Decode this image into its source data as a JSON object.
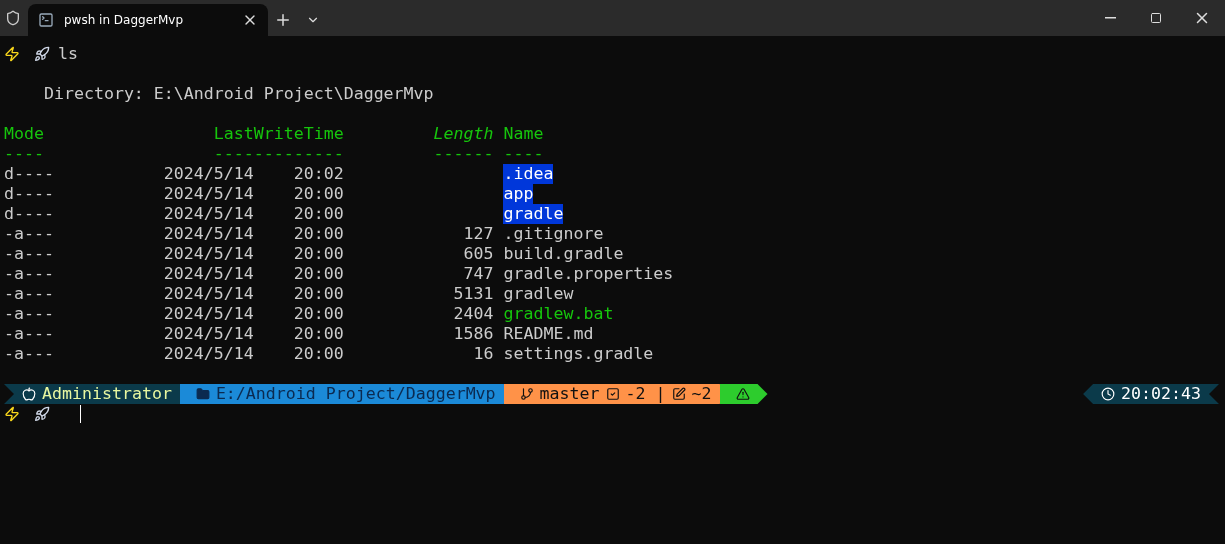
{
  "window": {
    "tabs": [
      {
        "title": "pwsh in DaggerMvp",
        "selected": true
      }
    ]
  },
  "terminal": {
    "command": "ls",
    "directory_line": "Directory: E:\\Android Project\\DaggerMvp",
    "columns": [
      {
        "label": "Mode",
        "underline": "----",
        "emphasized": false
      },
      {
        "label": "LastWriteTime",
        "underline": "-------------",
        "emphasized": false
      },
      {
        "label": "Length",
        "underline": "------",
        "emphasized": true
      },
      {
        "label": "Name",
        "underline": "----",
        "emphasized": false
      }
    ],
    "rows": [
      {
        "mode": "d----",
        "date": "2024/5/14",
        "time": "20:02",
        "length": "",
        "name": ".idea",
        "kind": "directory"
      },
      {
        "mode": "d----",
        "date": "2024/5/14",
        "time": "20:00",
        "length": "",
        "name": "app",
        "kind": "directory"
      },
      {
        "mode": "d----",
        "date": "2024/5/14",
        "time": "20:00",
        "length": "",
        "name": "gradle",
        "kind": "directory"
      },
      {
        "mode": "-a---",
        "date": "2024/5/14",
        "time": "20:00",
        "length": "127",
        "name": ".gitignore",
        "kind": "file"
      },
      {
        "mode": "-a---",
        "date": "2024/5/14",
        "time": "20:00",
        "length": "605",
        "name": "build.gradle",
        "kind": "file"
      },
      {
        "mode": "-a---",
        "date": "2024/5/14",
        "time": "20:00",
        "length": "747",
        "name": "gradle.properties",
        "kind": "file"
      },
      {
        "mode": "-a---",
        "date": "2024/5/14",
        "time": "20:00",
        "length": "5131",
        "name": "gradlew",
        "kind": "file"
      },
      {
        "mode": "-a---",
        "date": "2024/5/14",
        "time": "20:00",
        "length": "2404",
        "name": "gradlew.bat",
        "kind": "executable"
      },
      {
        "mode": "-a---",
        "date": "2024/5/14",
        "time": "20:00",
        "length": "1586",
        "name": "README.md",
        "kind": "file"
      },
      {
        "mode": "-a---",
        "date": "2024/5/14",
        "time": "20:00",
        "length": "16",
        "name": "settings.gradle",
        "kind": "file"
      }
    ],
    "prompt": {
      "user": "Administrator",
      "path": "E:/Android Project/DaggerMvp",
      "branch": "master",
      "staged": "-2",
      "separator": "|",
      "modified": "~2",
      "time": "20:02:43"
    }
  }
}
